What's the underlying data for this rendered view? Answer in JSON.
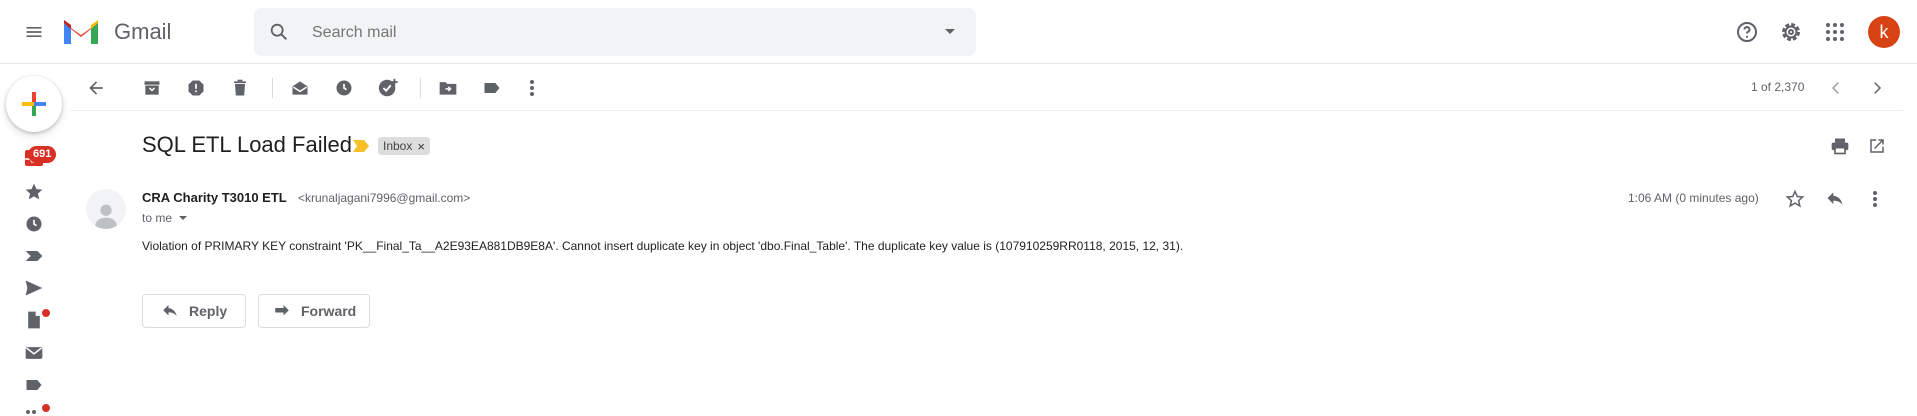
{
  "header": {
    "app_name": "Gmail",
    "search_placeholder": "Search mail",
    "avatar_initial": "k",
    "avatar_color": "#d84315"
  },
  "sidebar": {
    "inbox_badge": "691"
  },
  "toolbar": {
    "pagination": "1 of 2,370"
  },
  "email": {
    "subject": "SQL ETL Load Failed",
    "label": "Inbox",
    "label_remove": "×",
    "sender_name": "CRA Charity T3010 ETL",
    "sender_email": "<krunaljagani7996@gmail.com>",
    "recipient": "to me",
    "time": "1:06 AM (0 minutes ago)",
    "body": "Violation of PRIMARY KEY constraint 'PK__Final_Ta__A2E93EA881DB9E8A'. Cannot insert duplicate key in object 'dbo.Final_Table'. The duplicate key value is (107910259RR0118, 2015, 12, 31)."
  },
  "actions": {
    "reply_label": "Reply",
    "forward_label": "Forward"
  }
}
